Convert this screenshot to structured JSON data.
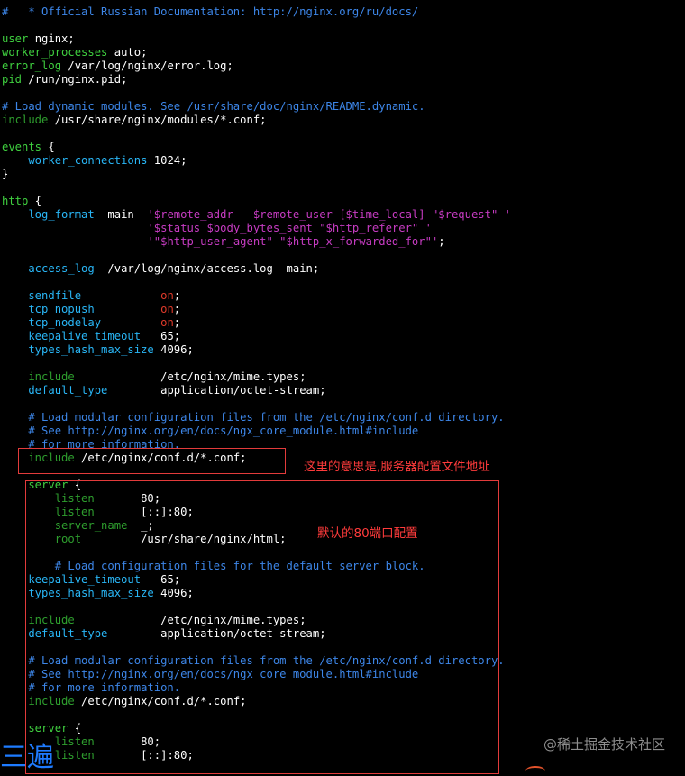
{
  "colors": {
    "background": "#000000",
    "comment": "#3d86e8",
    "keyword": "#3fcf3f",
    "directive": "#29b6f6",
    "text": "#ffffff",
    "value_on": "#e03a2a",
    "string": "#c73cc3",
    "include": "#2e9e2e",
    "annotation": "#ff3b3b",
    "annotation_box": "#e23b3b"
  },
  "lines": [
    [
      {
        "t": "#   * Official Russian Documentation: http://nginx.org/ru/docs/",
        "c": "comment"
      }
    ],
    [],
    [
      {
        "t": "user",
        "c": "keyword"
      },
      {
        "t": " nginx;",
        "c": "text"
      }
    ],
    [
      {
        "t": "worker_processes",
        "c": "keyword"
      },
      {
        "t": " auto;",
        "c": "text"
      }
    ],
    [
      {
        "t": "error_log",
        "c": "keyword"
      },
      {
        "t": " /var/log/nginx/error.log;",
        "c": "text"
      }
    ],
    [
      {
        "t": "pid",
        "c": "keyword"
      },
      {
        "t": " /run/nginx.pid;",
        "c": "text"
      }
    ],
    [],
    [
      {
        "t": "# Load dynamic modules. See /usr/share/doc/nginx/README.dynamic.",
        "c": "comment"
      }
    ],
    [
      {
        "t": "include",
        "c": "include"
      },
      {
        "t": " /usr/share/nginx/modules/*.conf;",
        "c": "text"
      }
    ],
    [],
    [
      {
        "t": "events",
        "c": "keyword"
      },
      {
        "t": " {",
        "c": "text"
      }
    ],
    [
      {
        "t": "    worker_connections",
        "c": "directive"
      },
      {
        "t": " 1024;",
        "c": "text"
      }
    ],
    [
      {
        "t": "}",
        "c": "text"
      }
    ],
    [],
    [
      {
        "t": "http",
        "c": "keyword"
      },
      {
        "t": " {",
        "c": "text"
      }
    ],
    [
      {
        "t": "    log_format",
        "c": "directive"
      },
      {
        "t": "  main  ",
        "c": "text"
      },
      {
        "t": "'$remote_addr - $remote_user [$time_local] \"$request\" '",
        "c": "string"
      }
    ],
    [
      {
        "t": "                      ",
        "c": "text"
      },
      {
        "t": "'$status $body_bytes_sent \"$http_referer\" '",
        "c": "string"
      }
    ],
    [
      {
        "t": "                      ",
        "c": "text"
      },
      {
        "t": "'\"$http_user_agent\" \"$http_x_forwarded_for\"'",
        "c": "string"
      },
      {
        "t": ";",
        "c": "text"
      }
    ],
    [],
    [
      {
        "t": "    access_log",
        "c": "directive"
      },
      {
        "t": "  /var/log/nginx/access.log  main;",
        "c": "text"
      }
    ],
    [],
    [
      {
        "t": "    sendfile",
        "c": "directive"
      },
      {
        "t": "            ",
        "c": "text"
      },
      {
        "t": "on",
        "c": "value_on"
      },
      {
        "t": ";",
        "c": "text"
      }
    ],
    [
      {
        "t": "    tcp_nopush",
        "c": "directive"
      },
      {
        "t": "          ",
        "c": "text"
      },
      {
        "t": "on",
        "c": "value_on"
      },
      {
        "t": ";",
        "c": "text"
      }
    ],
    [
      {
        "t": "    tcp_nodelay",
        "c": "directive"
      },
      {
        "t": "         ",
        "c": "text"
      },
      {
        "t": "on",
        "c": "value_on"
      },
      {
        "t": ";",
        "c": "text"
      }
    ],
    [
      {
        "t": "    keepalive_timeout",
        "c": "directive"
      },
      {
        "t": "   65;",
        "c": "text"
      }
    ],
    [
      {
        "t": "    types_hash_max_size",
        "c": "directive"
      },
      {
        "t": " 4096;",
        "c": "text"
      }
    ],
    [],
    [
      {
        "t": "    include",
        "c": "include"
      },
      {
        "t": "             /etc/nginx/mime.types;",
        "c": "text"
      }
    ],
    [
      {
        "t": "    default_type",
        "c": "directive"
      },
      {
        "t": "        application/octet-stream;",
        "c": "text"
      }
    ],
    [],
    [
      {
        "t": "    # Load modular configuration files from the /etc/nginx/conf.d directory.",
        "c": "comment"
      }
    ],
    [
      {
        "t": "    # See http://nginx.org/en/docs/ngx_core_module.html#include",
        "c": "comment"
      }
    ],
    [
      {
        "t": "    # for more information.",
        "c": "comment"
      }
    ],
    [
      {
        "t": "    include",
        "c": "include"
      },
      {
        "t": " /etc/nginx/conf.d/*.conf;",
        "c": "text"
      }
    ],
    [],
    [
      {
        "t": "    server",
        "c": "keyword"
      },
      {
        "t": " {",
        "c": "text"
      }
    ],
    [
      {
        "t": "        listen",
        "c": "include"
      },
      {
        "t": "       80;",
        "c": "text"
      }
    ],
    [
      {
        "t": "        listen",
        "c": "include"
      },
      {
        "t": "       [::]:80;",
        "c": "text"
      }
    ],
    [
      {
        "t": "        server_name",
        "c": "include"
      },
      {
        "t": "  _;",
        "c": "text"
      }
    ],
    [
      {
        "t": "        root",
        "c": "include"
      },
      {
        "t": "         /usr/share/nginx/html;",
        "c": "text"
      }
    ],
    [],
    [
      {
        "t": "        # Load configuration files for the default server block.",
        "c": "comment"
      }
    ],
    [
      {
        "t": "    keepalive_timeout",
        "c": "directive"
      },
      {
        "t": "   65;",
        "c": "text"
      }
    ],
    [
      {
        "t": "    types_hash_max_size",
        "c": "directive"
      },
      {
        "t": " 4096;",
        "c": "text"
      }
    ],
    [],
    [
      {
        "t": "    include",
        "c": "include"
      },
      {
        "t": "             /etc/nginx/mime.types;",
        "c": "text"
      }
    ],
    [
      {
        "t": "    default_type",
        "c": "directive"
      },
      {
        "t": "        application/octet-stream;",
        "c": "text"
      }
    ],
    [],
    [
      {
        "t": "    # Load modular configuration files from the /etc/nginx/conf.d directory.",
        "c": "comment"
      }
    ],
    [
      {
        "t": "    # See http://nginx.org/en/docs/ngx_core_module.html#include",
        "c": "comment"
      }
    ],
    [
      {
        "t": "    # for more information.",
        "c": "comment"
      }
    ],
    [
      {
        "t": "    include",
        "c": "include"
      },
      {
        "t": " /etc/nginx/conf.d/*.conf;",
        "c": "text"
      }
    ],
    [],
    [
      {
        "t": "    server",
        "c": "keyword"
      },
      {
        "t": " {",
        "c": "text"
      }
    ],
    [
      {
        "t": "        listen",
        "c": "include"
      },
      {
        "t": "       80;",
        "c": "text"
      }
    ],
    [
      {
        "t": "        listen",
        "c": "include"
      },
      {
        "t": "       [::]:80;",
        "c": "text"
      }
    ]
  ],
  "annotations": {
    "include_note": "这里的意思是,服务器配置文件地址",
    "server_note": "默认的80端口配置"
  },
  "watermark": "@稀土掘金技术社区",
  "edge_glyph": "三遍"
}
